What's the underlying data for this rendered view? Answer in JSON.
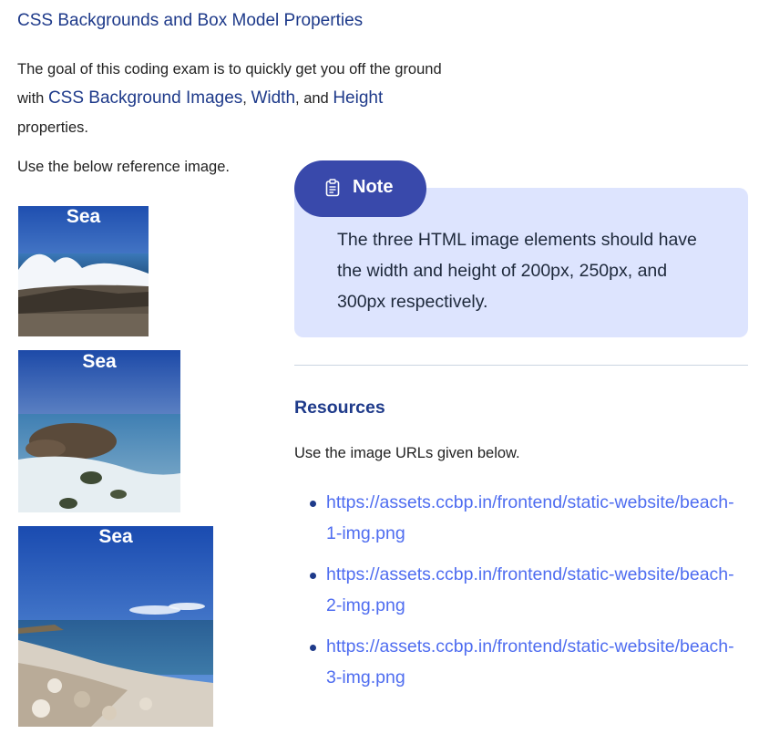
{
  "page": {
    "title": "CSS Backgrounds and Box Model Properties",
    "intro": {
      "before": "The goal of this coding exam is to quickly get you off the ground with ",
      "term1": "CSS Background Images",
      "sep1": ", ",
      "term2": "Width",
      "sep2": ", and ",
      "term3": "Height",
      "after": " properties."
    },
    "reference_text": "Use the below reference image."
  },
  "images": [
    {
      "caption": "Sea"
    },
    {
      "caption": "Sea"
    },
    {
      "caption": "Sea"
    }
  ],
  "note": {
    "label": "Note",
    "text": "The three HTML image elements should have the width and height of 200px, 250px, and 300px respectively."
  },
  "resources": {
    "title": "Resources",
    "description": "Use the image URLs given below.",
    "links": [
      "https://assets.ccbp.in/frontend/static-website/beach-1-img.png",
      "https://assets.ccbp.in/frontend/static-website/beach-2-img.png",
      "https://assets.ccbp.in/frontend/static-website/beach-3-img.png"
    ]
  },
  "colors": {
    "heading": "#1e3a8a",
    "note_tab": "#3949ab",
    "note_box": "#dde4fe",
    "link": "#4f6df0"
  }
}
